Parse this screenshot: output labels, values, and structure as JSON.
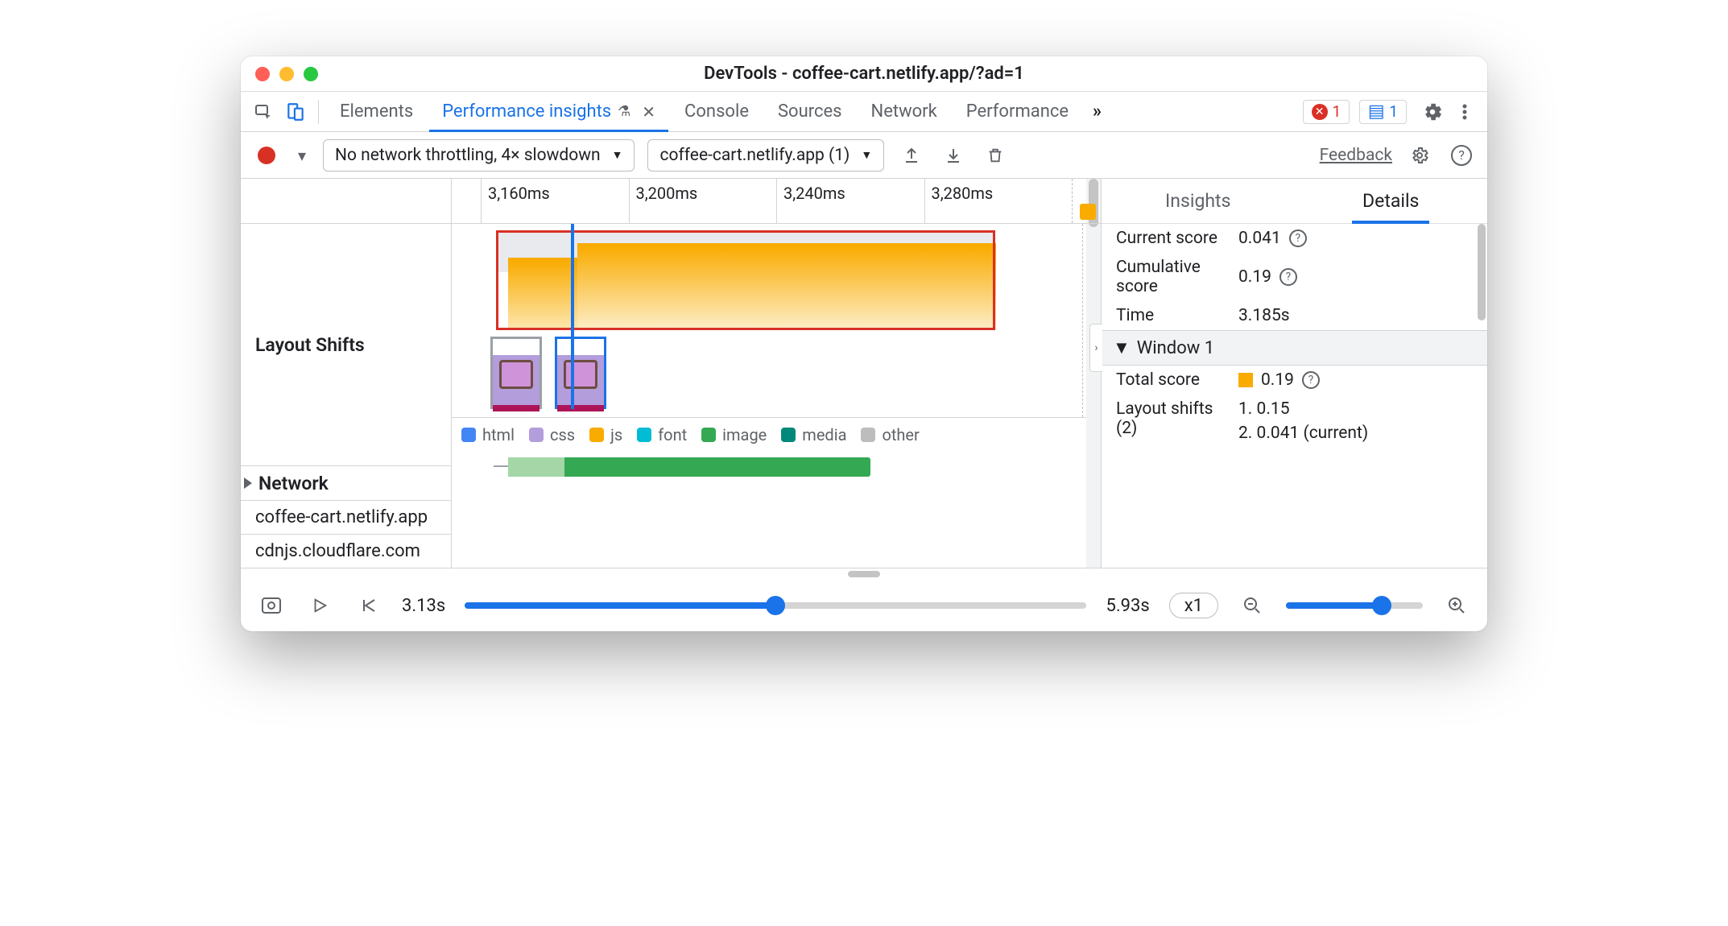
{
  "window": {
    "title": "DevTools - coffee-cart.netlify.app/?ad=1"
  },
  "tabs": {
    "elements": "Elements",
    "perf_insights": "Performance insights",
    "console": "Console",
    "sources": "Sources",
    "network": "Network",
    "performance": "Performance"
  },
  "badges": {
    "errors": "1",
    "messages": "1"
  },
  "toolbar": {
    "throttle": "No network throttling, 4× slowdown",
    "session": "coffee-cart.netlify.app (1)",
    "feedback": "Feedback"
  },
  "ruler": {
    "t0": "3,160ms",
    "t1": "3,200ms",
    "t2": "3,240ms",
    "t3": "3,280ms"
  },
  "left": {
    "layout_shifts": "Layout Shifts",
    "network": "Network",
    "host1": "coffee-cart.netlify.app",
    "host2": "cdnjs.cloudflare.com"
  },
  "legend": {
    "html": "html",
    "css": "css",
    "js": "js",
    "font": "font",
    "image": "image",
    "media": "media",
    "other": "other"
  },
  "details": {
    "tab_insights": "Insights",
    "tab_details": "Details",
    "current_score_k": "Current score",
    "current_score_v": "0.041",
    "cumulative_score_k": "Cumulative score",
    "cumulative_score_v": "0.19",
    "time_k": "Time",
    "time_v": "3.185s",
    "window_head": "Window 1",
    "total_score_k": "Total score",
    "total_score_v": "0.19",
    "layout_shifts_k": "Layout shifts (2)",
    "ls1": "1. 0.15",
    "ls2": "2. 0.041 (current)"
  },
  "playbar": {
    "start": "3.13s",
    "end": "5.93s",
    "speed": "x1"
  },
  "colors": {
    "html": "#4285f4",
    "css": "#b39ddb",
    "js": "#f9ab00",
    "font": "#00bcd4",
    "image": "#34a853",
    "media": "#00897b",
    "other": "#bdbdbd"
  }
}
